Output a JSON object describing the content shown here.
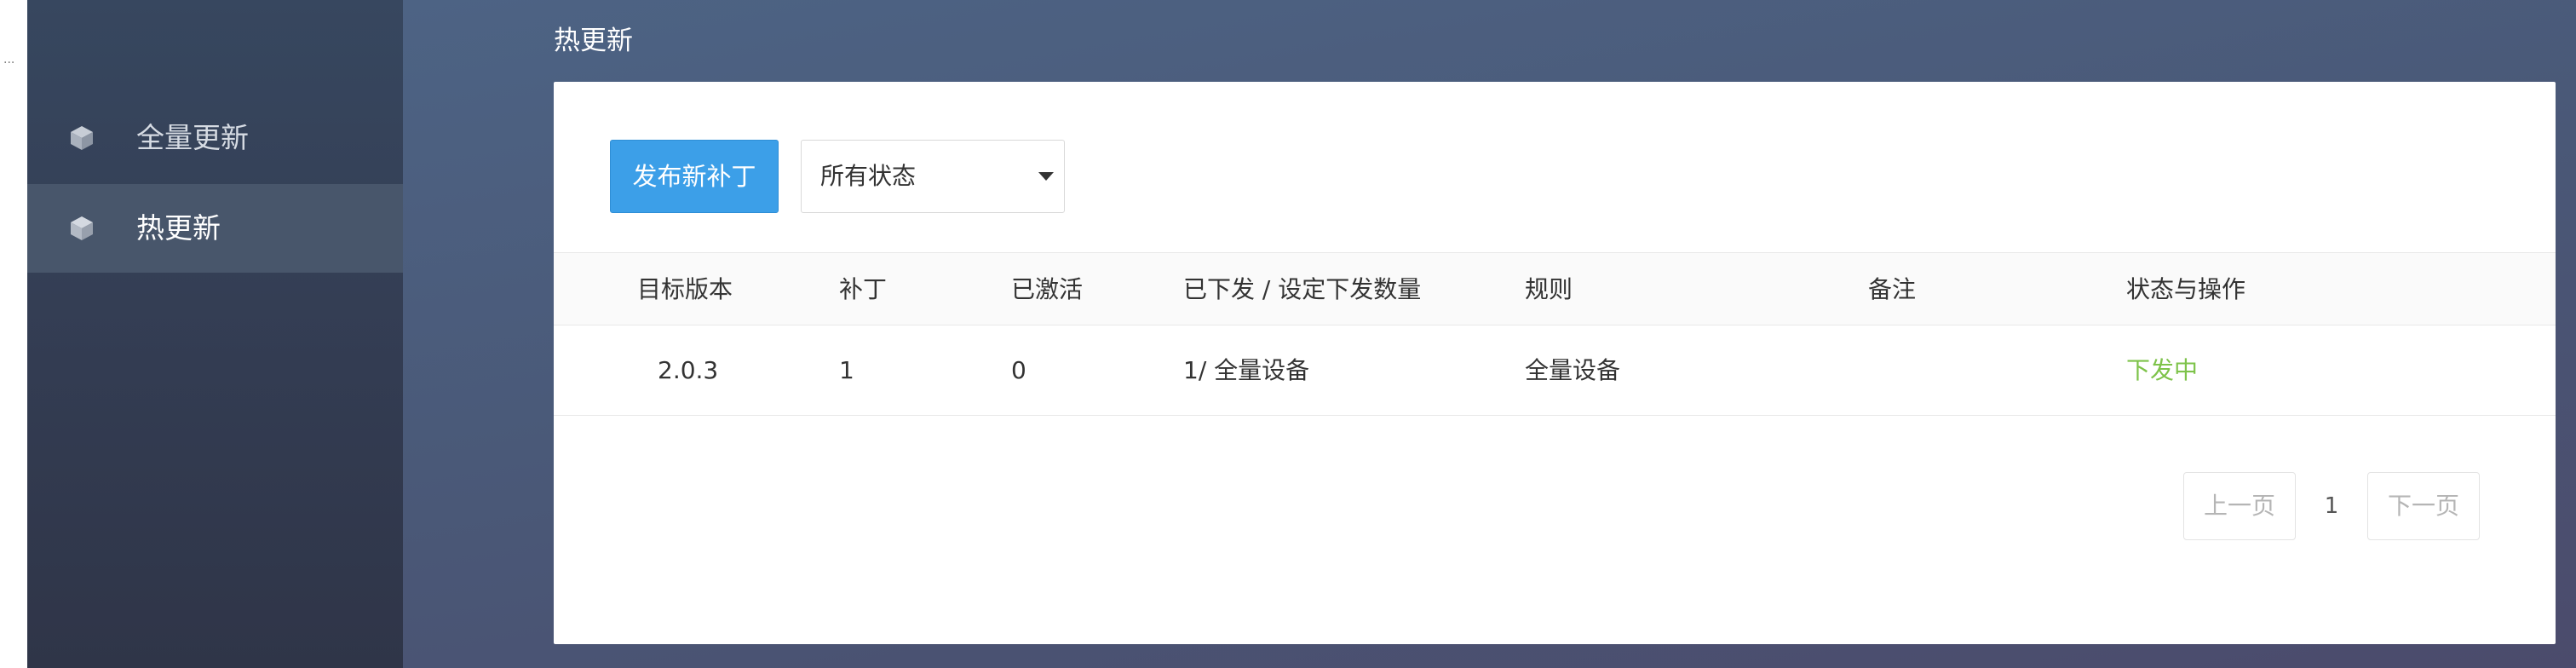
{
  "edge": {
    "dots": "..."
  },
  "sidebar": {
    "items": [
      {
        "label": "全量更新",
        "icon": "cube-icon",
        "active": false
      },
      {
        "label": "热更新",
        "icon": "cube-icon",
        "active": true
      }
    ]
  },
  "main": {
    "title": "热更新",
    "toolbar": {
      "publish_label": "发布新补丁",
      "status_filter": {
        "selected": "所有状态"
      }
    },
    "table": {
      "headers": [
        "目标版本",
        "补丁",
        "已激活",
        "已下发 / 设定下发数量",
        "规则",
        "备注",
        "状态与操作"
      ],
      "rows": [
        {
          "version": "2.0.3",
          "patch": "1",
          "active": "0",
          "sent": "1/ 全量设备",
          "rule": "全量设备",
          "note": "",
          "status": "下发中"
        }
      ]
    },
    "pagination": {
      "prev": "上一页",
      "page": "1",
      "next": "下一页"
    }
  },
  "colors": {
    "accent": "#3c9fe8",
    "status_running": "#7ec34a",
    "sidebar_active": "#48566b"
  }
}
